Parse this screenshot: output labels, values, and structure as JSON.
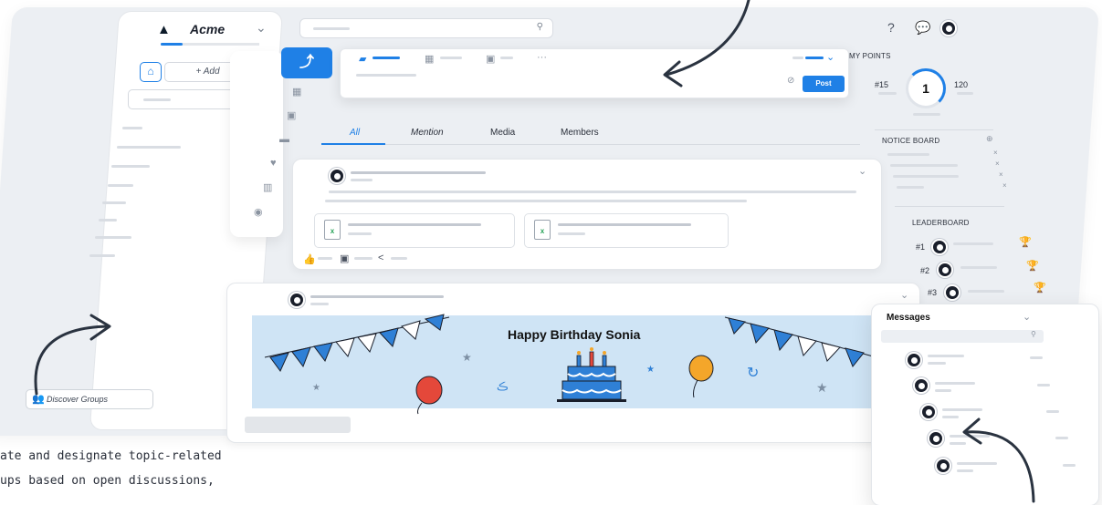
{
  "org": {
    "name": "Acme"
  },
  "sidebar": {
    "add_label": "+ Add",
    "discover_label": "Discover Groups"
  },
  "feed_tabs": [
    "All",
    "Mention",
    "Media",
    "Members"
  ],
  "composer": {
    "post_label": "Post"
  },
  "banner": {
    "title": "Happy Birthday Sonia"
  },
  "points": {
    "title": "MY POINTS",
    "rank": "#15",
    "value": "1",
    "next": "120"
  },
  "notice_board": {
    "title": "NOTICE BOARD"
  },
  "leaderboard": {
    "title": "LEADERBOARD",
    "ranks": [
      "#1",
      "#2",
      "#3"
    ]
  },
  "messages": {
    "title": "Messages"
  },
  "caption": {
    "line1": "ate and designate topic-related",
    "line2": "ups based on open discussions,"
  },
  "colors": {
    "accent": "#1f80e6",
    "board": "#eceff3",
    "banner": "#cfe4f5"
  }
}
